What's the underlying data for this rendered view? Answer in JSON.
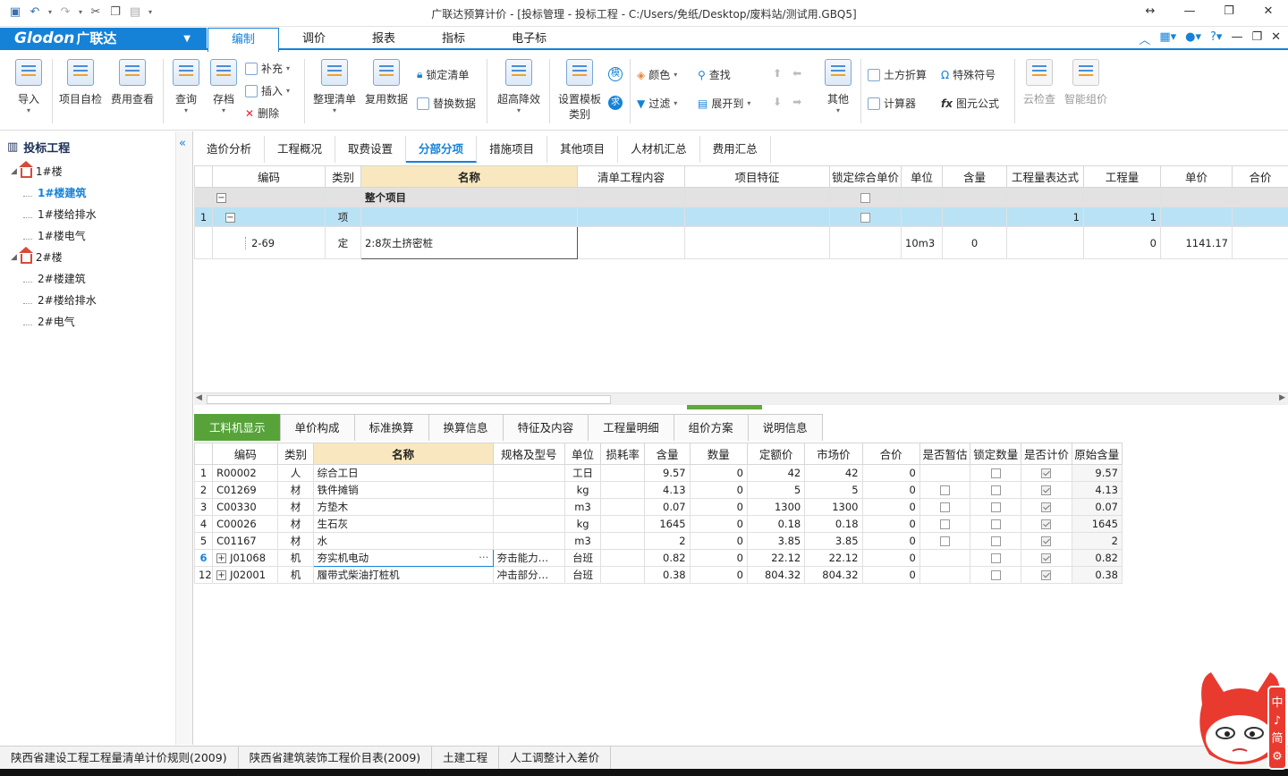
{
  "window": {
    "title": "广联达预算计价 - [投标管理 - 投标工程 - C:/Users/免纸/Desktop/废料站/测试用.GBQ5]"
  },
  "menu": {
    "logo": "Glodon",
    "logo_cn": "广联达",
    "items": [
      "编制",
      "调价",
      "报表",
      "指标",
      "电子标"
    ],
    "active": "编制"
  },
  "ribbon": {
    "import": "导入",
    "selfcheck": "项目自检",
    "fee_view": "费用查看",
    "query": "查询",
    "save": "存档",
    "supplement": "补充",
    "insert": "插入",
    "delete": "删除",
    "organize": "整理清单",
    "reuse": "复用数据",
    "lock_list": "锁定清单",
    "replace_data": "替换数据",
    "super_height": "超高降效",
    "template": "设置模板",
    "template2": "类别",
    "color": "颜色",
    "filter": "过滤",
    "find": "查找",
    "expand_to": "展开到",
    "other": "其他",
    "earth": "土方折算",
    "calc": "计算器",
    "special": "特殊符号",
    "formula": "图元公式",
    "cloud_check": "云检查",
    "smart_price": "智能组价"
  },
  "tree": {
    "root": "投标工程",
    "items": [
      {
        "label": "1#楼",
        "level": 1
      },
      {
        "label": "1#楼建筑",
        "level": 2,
        "selected": true
      },
      {
        "label": "1#楼给排水",
        "level": 2
      },
      {
        "label": "1#楼电气",
        "level": 2
      },
      {
        "label": "2#楼",
        "level": 1
      },
      {
        "label": "2#楼建筑",
        "level": 2
      },
      {
        "label": "2#楼给排水",
        "level": 2
      },
      {
        "label": "2#电气",
        "level": 2
      }
    ]
  },
  "top_tabs": [
    "造价分析",
    "工程概况",
    "取费设置",
    "分部分项",
    "措施项目",
    "其他项目",
    "人材机汇总",
    "费用汇总"
  ],
  "top_tab_active": "分部分项",
  "grid1": {
    "headers": [
      "",
      "编码",
      "类别",
      "名称",
      "清单工程内容",
      "项目特征",
      "锁定综合单价",
      "单位",
      "含量",
      "工程量表达式",
      "工程量",
      "单价",
      "合价"
    ],
    "rows": [
      {
        "no": "",
        "code": "",
        "type": "",
        "name": "整个项目",
        "unit": "",
        "content": "",
        "expr": "",
        "qty": "",
        "price": "",
        "total": ""
      },
      {
        "no": "1",
        "code": "",
        "type": "项",
        "name": "",
        "unit": "",
        "content": "",
        "expr": "1",
        "qty": "1",
        "price": "",
        "total": ""
      },
      {
        "no": "",
        "code": "2-69",
        "type": "定",
        "name": "2:8灰土挤密桩",
        "unit": "10m3",
        "content": "0",
        "expr": "",
        "qty": "0",
        "price": "1141.17",
        "total": ""
      }
    ]
  },
  "bottom_tabs": [
    "工料机显示",
    "单价构成",
    "标准换算",
    "换算信息",
    "特征及内容",
    "工程量明细",
    "组价方案",
    "说明信息"
  ],
  "bottom_tab_active": "工料机显示",
  "grid2": {
    "headers": [
      "",
      "编码",
      "类别",
      "名称",
      "规格及型号",
      "单位",
      "损耗率",
      "含量",
      "数量",
      "定额价",
      "市场价",
      "合价",
      "是否暂估",
      "锁定数量",
      "是否计价",
      "原始含量"
    ],
    "rows": [
      {
        "no": "1",
        "code": "R00002",
        "type": "人",
        "name": "综合工日",
        "spec": "",
        "unit": "工日",
        "loss": "",
        "content": "9.57",
        "qty": "0",
        "quota": "42",
        "market": "42",
        "total": "0",
        "est": false,
        "lock": false,
        "priced": true,
        "orig": "9.57",
        "expand": false,
        "estbox": false
      },
      {
        "no": "2",
        "code": "C01269",
        "type": "材",
        "name": "铁件摊销",
        "spec": "",
        "unit": "kg",
        "loss": "",
        "content": "4.13",
        "qty": "0",
        "quota": "5",
        "market": "5",
        "total": "0",
        "est": false,
        "lock": false,
        "priced": true,
        "orig": "4.13",
        "expand": false,
        "estbox": true
      },
      {
        "no": "3",
        "code": "C00330",
        "type": "材",
        "name": "方垫木",
        "spec": "",
        "unit": "m3",
        "loss": "",
        "content": "0.07",
        "qty": "0",
        "quota": "1300",
        "market": "1300",
        "total": "0",
        "est": false,
        "lock": false,
        "priced": true,
        "orig": "0.07",
        "expand": false,
        "estbox": true
      },
      {
        "no": "4",
        "code": "C00026",
        "type": "材",
        "name": "生石灰",
        "spec": "",
        "unit": "kg",
        "loss": "",
        "content": "1645",
        "qty": "0",
        "quota": "0.18",
        "market": "0.18",
        "total": "0",
        "est": false,
        "lock": false,
        "priced": true,
        "orig": "1645",
        "expand": false,
        "estbox": true
      },
      {
        "no": "5",
        "code": "C01167",
        "type": "材",
        "name": "水",
        "spec": "",
        "unit": "m3",
        "loss": "",
        "content": "2",
        "qty": "0",
        "quota": "3.85",
        "market": "3.85",
        "total": "0",
        "est": false,
        "lock": false,
        "priced": true,
        "orig": "2",
        "expand": false,
        "estbox": true
      },
      {
        "no": "6",
        "code": "J01068",
        "type": "机",
        "name": "夯实机电动",
        "spec": "夯击能力…",
        "unit": "台班",
        "loss": "",
        "content": "0.82",
        "qty": "0",
        "quota": "22.12",
        "market": "22.12",
        "total": "0",
        "est": false,
        "lock": false,
        "priced": true,
        "orig": "0.82",
        "expand": true,
        "estbox": false,
        "selected": true
      },
      {
        "no": "12",
        "code": "J02001",
        "type": "机",
        "name": "履带式柴油打桩机",
        "spec": "冲击部分…",
        "unit": "台班",
        "loss": "",
        "content": "0.38",
        "qty": "0",
        "quota": "804.32",
        "market": "804.32",
        "total": "0",
        "est": false,
        "lock": false,
        "priced": true,
        "orig": "0.38",
        "expand": true,
        "estbox": false
      }
    ]
  },
  "status": [
    "陕西省建设工程工程量清单计价规则(2009)",
    "陕西省建筑装饰工程价目表(2009)",
    "土建工程",
    "人工调整计入差价"
  ],
  "colors": {
    "accent": "#1582d8",
    "tab_green": "#57a33a",
    "header_highlight": "#f9e8bf",
    "row_selected": "#b9e3f5"
  }
}
